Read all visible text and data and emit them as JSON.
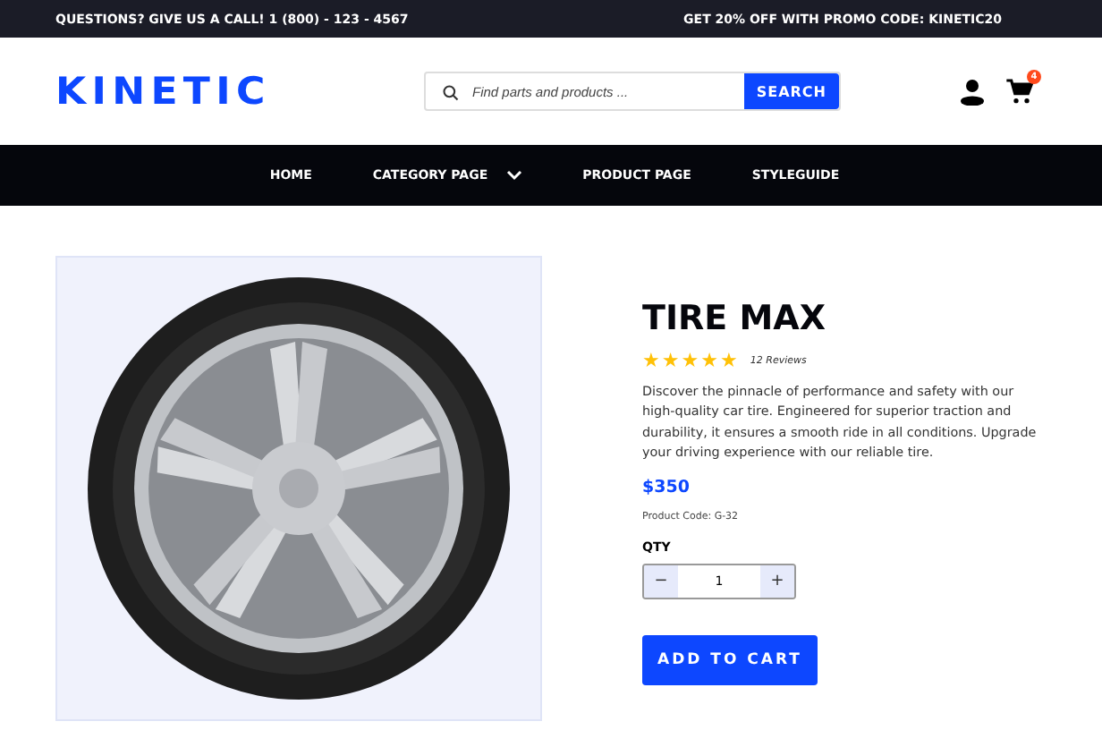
{
  "top_bar": {
    "left": "QUESTIONS? GIVE US A CALL!  1 (800) - 123 - 4567",
    "right": "GET 20% OFF  WITH PROMO CODE: KINETIC20"
  },
  "header": {
    "logo": "KINETIC",
    "search": {
      "placeholder": "Find parts and products ...",
      "button": "SEARCH"
    },
    "cart_count": "4"
  },
  "nav": [
    {
      "label": "HOME",
      "dropdown": false
    },
    {
      "label": "CATEGORY PAGE",
      "dropdown": true
    },
    {
      "label": "PRODUCT PAGE",
      "dropdown": false
    },
    {
      "label": "STYLEGUIDE",
      "dropdown": false
    }
  ],
  "product": {
    "title": "TIRE MAX",
    "stars": 5,
    "reviews": "12 Reviews",
    "description": "Discover the pinnacle of performance and safety with our high-quality car tire. Engineered for superior traction and durability, it ensures a smooth ride in all conditions. Upgrade your driving experience with our reliable tire.",
    "price": "$350",
    "code": "Product Code: G-32",
    "qty_label": "QTY",
    "qty": "1",
    "decrement": "−",
    "increment": "+",
    "add_button": "ADD TO CART"
  }
}
